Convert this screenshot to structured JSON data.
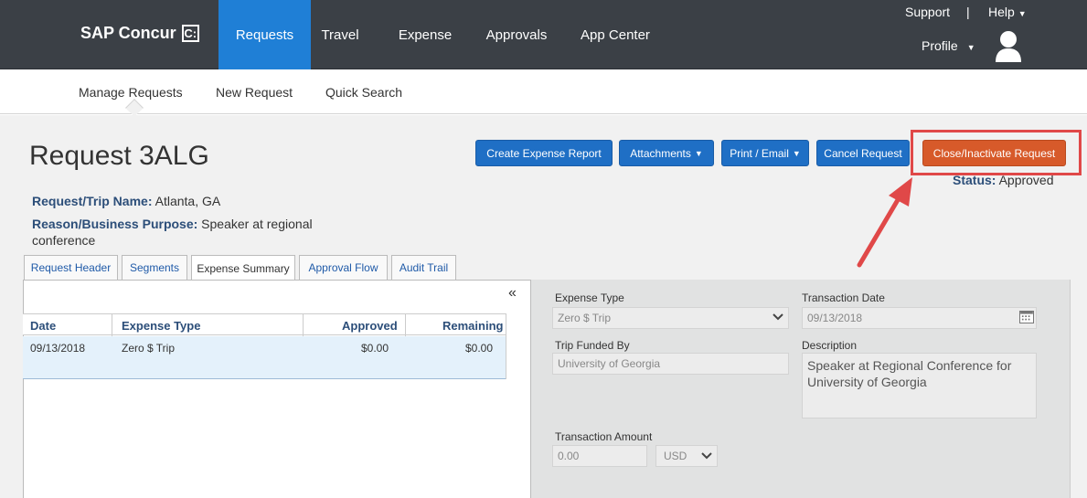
{
  "topnav": {
    "logo_text": "SAP Concur",
    "logo_mark": "C:",
    "tabs": [
      {
        "label": "Requests",
        "active": true
      },
      {
        "label": "Travel"
      },
      {
        "label": "Expense"
      },
      {
        "label": "Approvals"
      },
      {
        "label": "App Center"
      }
    ],
    "support": "Support",
    "separator": "|",
    "help": "Help",
    "profile": "Profile"
  },
  "subnav": {
    "tabs": [
      "Manage Requests",
      "New Request",
      "Quick Search"
    ]
  },
  "request": {
    "title": "Request 3ALG",
    "trip_name_label": "Request/Trip Name:",
    "trip_name_value": "Atlanta, GA",
    "reason_label": "Reason/Business Purpose:",
    "reason_value": "Speaker at regional conference",
    "status_label": "Status:",
    "status_value": "Approved"
  },
  "actions": {
    "create_expense_report": "Create Expense Report",
    "attachments": "Attachments",
    "print_email": "Print / Email",
    "cancel_request": "Cancel Request",
    "close_inactivate": "Close/Inactivate Request"
  },
  "tabs": [
    "Request Header",
    "Segments",
    "Expense Summary",
    "Approval Flow",
    "Audit Trail"
  ],
  "expense_table": {
    "collapse_glyph": "«",
    "columns": [
      "Date",
      "Expense Type",
      "Approved",
      "Remaining"
    ],
    "rows": [
      {
        "date": "09/13/2018",
        "expense_type": "Zero $ Trip",
        "approved": "$0.00",
        "remaining": "$0.00"
      }
    ]
  },
  "form": {
    "expense_type_label": "Expense Type",
    "expense_type_value": "Zero $ Trip",
    "transaction_date_label": "Transaction Date",
    "transaction_date_value": "09/13/2018",
    "trip_funded_by_label": "Trip Funded By",
    "trip_funded_by_value": "University of Georgia",
    "description_label": "Description",
    "description_value": "Speaker at Regional Conference for University of Georgia",
    "transaction_amount_label": "Transaction Amount",
    "transaction_amount_value": "0.00",
    "currency_value": "USD"
  },
  "colors": {
    "nav_bg": "#3b4046",
    "active_tab": "#1f7fd6",
    "button_blue": "#1f6fc5",
    "button_orange": "#d75a2a",
    "highlight_red": "#e04848",
    "label_blue": "#2c4e79"
  }
}
